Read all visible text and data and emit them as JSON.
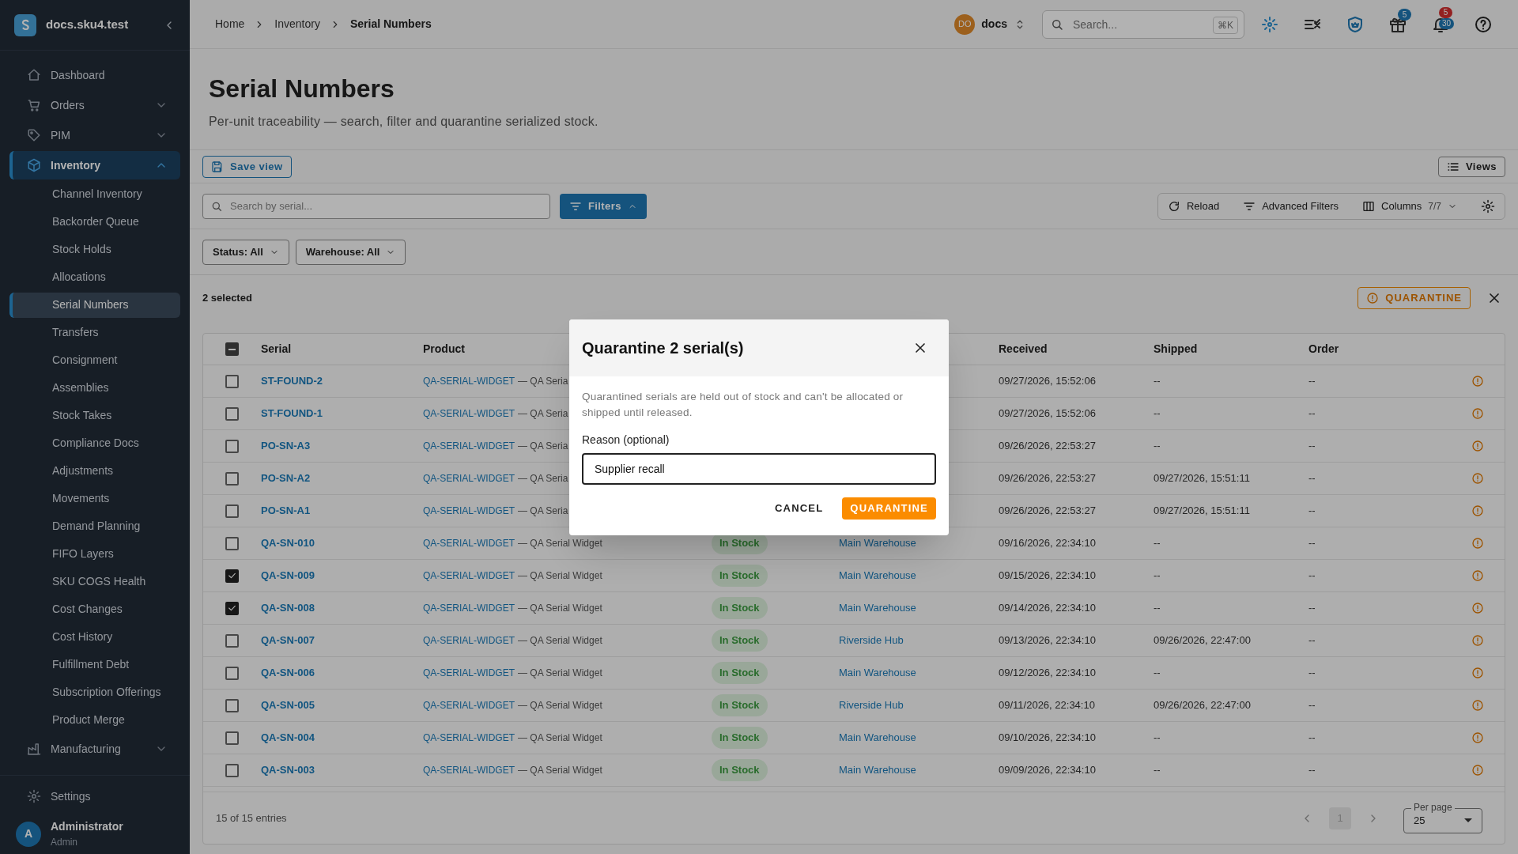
{
  "sidebar": {
    "brand": "docs.sku4.test",
    "nav": [
      {
        "label": "Dashboard",
        "selected": false
      },
      {
        "label": "Orders",
        "selected": false,
        "expanded": false
      },
      {
        "label": "PIM",
        "selected": false,
        "expanded": false
      },
      {
        "label": "Inventory",
        "selected": true,
        "expanded": true,
        "children": [
          {
            "label": "Channel Inventory",
            "selected": false
          },
          {
            "label": "Backorder Queue",
            "selected": false
          },
          {
            "label": "Stock Holds",
            "selected": false
          },
          {
            "label": "Allocations",
            "selected": false
          },
          {
            "label": "Serial Numbers",
            "selected": true
          },
          {
            "label": "Transfers",
            "selected": false
          },
          {
            "label": "Consignment",
            "selected": false
          },
          {
            "label": "Assemblies",
            "selected": false
          },
          {
            "label": "Stock Takes",
            "selected": false
          },
          {
            "label": "Compliance Docs",
            "selected": false
          },
          {
            "label": "Adjustments",
            "selected": false
          },
          {
            "label": "Movements",
            "selected": false
          },
          {
            "label": "Demand Planning",
            "selected": false
          },
          {
            "label": "FIFO Layers",
            "selected": false
          },
          {
            "label": "SKU COGS Health",
            "selected": false
          },
          {
            "label": "Cost Changes",
            "selected": false
          },
          {
            "label": "Cost History",
            "selected": false
          },
          {
            "label": "Fulfillment Debt",
            "selected": false
          },
          {
            "label": "Subscription Offerings",
            "selected": false
          },
          {
            "label": "Product Merge",
            "selected": false
          }
        ]
      },
      {
        "label": "Manufacturing",
        "selected": false,
        "expanded": false
      }
    ],
    "settings": "Settings",
    "user": {
      "initial": "A",
      "name": "Administrator",
      "role": "Admin"
    }
  },
  "topbar": {
    "breadcrumb": [
      "Home",
      "Inventory",
      "Serial Numbers"
    ],
    "workspace": {
      "initials": "DO",
      "name": "docs"
    },
    "search": {
      "placeholder": "Search...",
      "shortcut": "⌘K"
    },
    "gift_badge": "5",
    "bell_badges": [
      "5",
      "30"
    ]
  },
  "page": {
    "title": "Serial Numbers",
    "subtitle": "Per-unit traceability — search, filter and quarantine serialized stock."
  },
  "toolbar": {
    "save_view": "Save view",
    "views": "Views",
    "search": {
      "placeholder": "Search by serial..."
    },
    "filters": {
      "label": "Filters",
      "expanded": true
    },
    "reload": "Reload",
    "advanced_filters": "Advanced Filters",
    "columns": {
      "label": "Columns",
      "count": "7/7"
    },
    "chips": [
      "Status: All",
      "Warehouse: All"
    ]
  },
  "selection": {
    "count_text": "2 selected",
    "action": "QUARANTINE"
  },
  "table": {
    "select_all": {
      "indeterminate": true
    },
    "columns": [
      "Serial",
      "Product",
      "Received",
      "Shipped",
      "Order"
    ],
    "rows": [
      {
        "checked": false,
        "serial": "ST-FOUND-2",
        "sku": "QA-SERIAL-WIDGET",
        "product": "— QA Seria",
        "received": "09/27/2026, 15:52:06",
        "shipped": "--",
        "order": "--"
      },
      {
        "checked": false,
        "serial": "ST-FOUND-1",
        "sku": "QA-SERIAL-WIDGET",
        "product": "— QA Seria",
        "received": "09/27/2026, 15:52:06",
        "shipped": "--",
        "order": "--"
      },
      {
        "checked": false,
        "serial": "PO-SN-A3",
        "sku": "QA-SERIAL-WIDGET",
        "product": "— QA Seria",
        "received": "09/26/2026, 22:53:27",
        "shipped": "--",
        "order": "--"
      },
      {
        "checked": false,
        "serial": "PO-SN-A2",
        "sku": "QA-SERIAL-WIDGET",
        "product": "— QA Seria",
        "received": "09/26/2026, 22:53:27",
        "shipped": "09/27/2026, 15:51:11",
        "order": "--"
      },
      {
        "checked": false,
        "serial": "PO-SN-A1",
        "sku": "QA-SERIAL-WIDGET",
        "product": "— QA Seria",
        "received": "09/26/2026, 22:53:27",
        "shipped": "09/27/2026, 15:51:11",
        "order": "--"
      },
      {
        "checked": false,
        "serial": "QA-SN-010",
        "sku": "QA-SERIAL-WIDGET",
        "product": "— QA Serial Widget",
        "status": "In Stock",
        "warehouse": "Main Warehouse",
        "received": "09/16/2026, 22:34:10",
        "shipped": "--",
        "order": "--"
      },
      {
        "checked": true,
        "serial": "QA-SN-009",
        "sku": "QA-SERIAL-WIDGET",
        "product": "— QA Serial Widget",
        "status": "In Stock",
        "warehouse": "Main Warehouse",
        "received": "09/15/2026, 22:34:10",
        "shipped": "--",
        "order": "--"
      },
      {
        "checked": true,
        "serial": "QA-SN-008",
        "sku": "QA-SERIAL-WIDGET",
        "product": "— QA Serial Widget",
        "status": "In Stock",
        "warehouse": "Main Warehouse",
        "received": "09/14/2026, 22:34:10",
        "shipped": "--",
        "order": "--"
      },
      {
        "checked": false,
        "serial": "QA-SN-007",
        "sku": "QA-SERIAL-WIDGET",
        "product": "— QA Serial Widget",
        "status": "In Stock",
        "warehouse": "Riverside Hub",
        "received": "09/13/2026, 22:34:10",
        "shipped": "09/26/2026, 22:47:00",
        "order": "--"
      },
      {
        "checked": false,
        "serial": "QA-SN-006",
        "sku": "QA-SERIAL-WIDGET",
        "product": "— QA Serial Widget",
        "status": "In Stock",
        "warehouse": "Main Warehouse",
        "received": "09/12/2026, 22:34:10",
        "shipped": "--",
        "order": "--"
      },
      {
        "checked": false,
        "serial": "QA-SN-005",
        "sku": "QA-SERIAL-WIDGET",
        "product": "— QA Serial Widget",
        "status": "In Stock",
        "warehouse": "Riverside Hub",
        "received": "09/11/2026, 22:34:10",
        "shipped": "09/26/2026, 22:47:00",
        "order": "--"
      },
      {
        "checked": false,
        "serial": "QA-SN-004",
        "sku": "QA-SERIAL-WIDGET",
        "product": "— QA Serial Widget",
        "status": "In Stock",
        "warehouse": "Main Warehouse",
        "received": "09/10/2026, 22:34:10",
        "shipped": "--",
        "order": "--"
      },
      {
        "checked": false,
        "serial": "QA-SN-003",
        "sku": "QA-SERIAL-WIDGET",
        "product": "— QA Serial Widget",
        "status": "In Stock",
        "warehouse": "Main Warehouse",
        "received": "09/09/2026, 22:34:10",
        "shipped": "--",
        "order": "--"
      }
    ],
    "footer": {
      "entries": "15 of 15 entries",
      "page": "1",
      "per_page_label": "Per page",
      "per_page": "25"
    }
  },
  "dialog": {
    "title": "Quarantine 2 serial(s)",
    "text": "Quarantined serials are held out of stock and can't be allocated or shipped until released.",
    "field_label": "Reason (optional)",
    "field_value": "Supplier recall",
    "cancel": "CANCEL",
    "confirm": "QUARANTINE"
  }
}
